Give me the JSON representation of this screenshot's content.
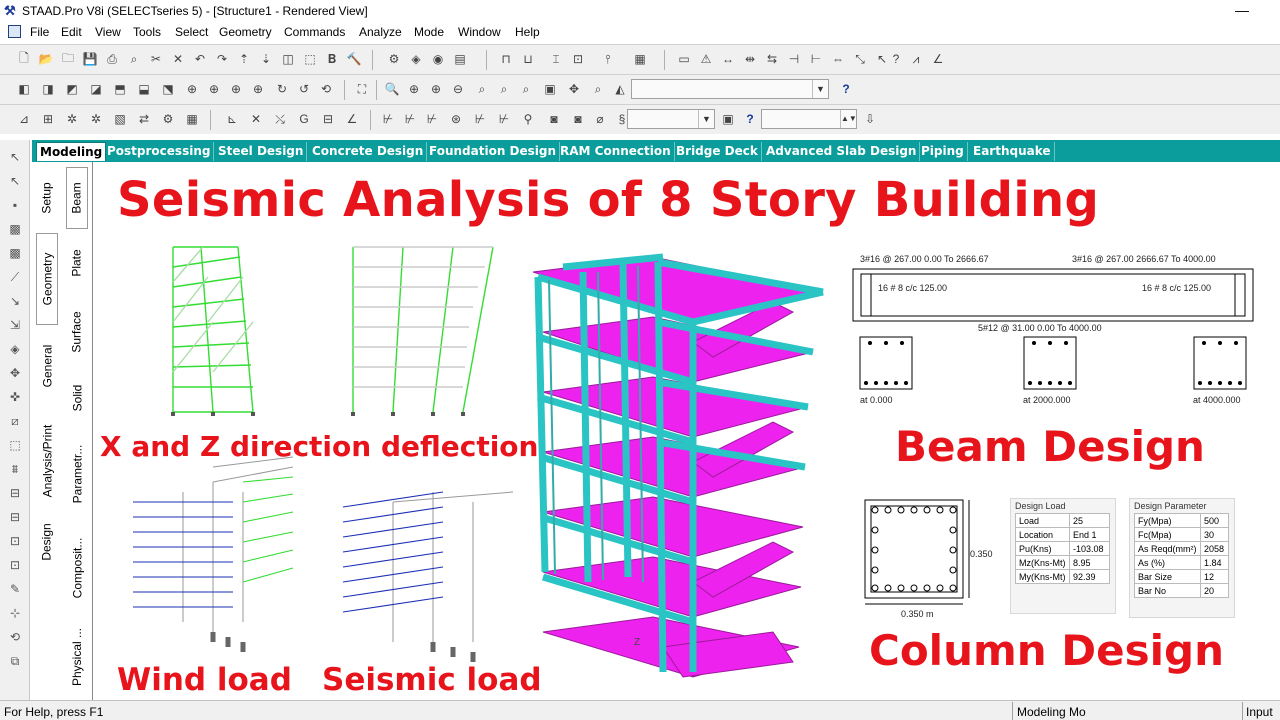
{
  "window": {
    "title": "STAAD.Pro V8i (SELECTseries 5) - [Structure1 - Rendered View]",
    "minimize_glyph": "—"
  },
  "menu": [
    "File",
    "Edit",
    "View",
    "Tools",
    "Select",
    "Geometry",
    "Commands",
    "Analyze",
    "Mode",
    "Window",
    "Help"
  ],
  "page_tabs": [
    "Modeling",
    "Postprocessing",
    "Steel Design",
    "Concrete Design",
    "Foundation Design",
    "RAM Connection",
    "Bridge Deck",
    "Advanced Slab Design",
    "Piping",
    "Earthquake"
  ],
  "active_page_tab": "Modeling",
  "vertical_tabs_left": [
    "Setup",
    "Geometry",
    "General",
    "Analysis/Print",
    "Design"
  ],
  "vertical_tabs_right": [
    "Beam",
    "Plate",
    "Surface",
    "Solid",
    "Parametr...",
    "Composit...",
    "Physical ..."
  ],
  "overlay": {
    "headline": "Seismic Analysis of 8 Story Building",
    "deflection_caption": "X and Z direction deflection",
    "wind_caption": "Wind load",
    "seismic_caption": "Seismic load",
    "beam_caption": "Beam Design",
    "column_caption": "Column Design"
  },
  "beam_design": {
    "top_left_rebar": "3#16 @ 267.00 0.00 To 2666.67",
    "top_right_rebar": "3#16 @ 267.00 2666.67 To 4000.00",
    "stirrup_left": "16 # 8 c/c 125.00",
    "stirrup_right": "16 # 8 c/c 125.00",
    "bottom_rebar": "5#12 @ 31.00 0.00 To 4000.00",
    "sections": [
      "at 0.000",
      "at 2000.000",
      "at 4000.000"
    ]
  },
  "column_design": {
    "height_label": "0.350",
    "width_label": "0.350 m",
    "design_load_title": "Design Load",
    "design_load": [
      [
        "Load",
        "25"
      ],
      [
        "Location",
        "End 1"
      ],
      [
        "Pu(Kns)",
        "-103.08"
      ],
      [
        "Mz(Kns-Mt)",
        "8.95"
      ],
      [
        "My(Kns-Mt)",
        "92.39"
      ]
    ],
    "design_param_title": "Design Parameter",
    "design_param": [
      [
        "Fy(Mpa)",
        "500"
      ],
      [
        "Fc(Mpa)",
        "30"
      ],
      [
        "As Reqd(mm²)",
        "2058"
      ],
      [
        "As (%)",
        "1.84"
      ],
      [
        "Bar Size",
        "12"
      ],
      [
        "Bar No",
        "20"
      ]
    ]
  },
  "axis_label": "Z",
  "status": {
    "help": "For Help, press F1",
    "mode": "Modeling Mo",
    "input": "Input U"
  },
  "colors": {
    "headline": "#e8141b",
    "tab_bar": "#0b9d9b",
    "frame_members": "#2ac4c4",
    "slabs": "#ee22ee",
    "deflection": "#33dd33",
    "load_arrows": "#1a2fb5"
  }
}
